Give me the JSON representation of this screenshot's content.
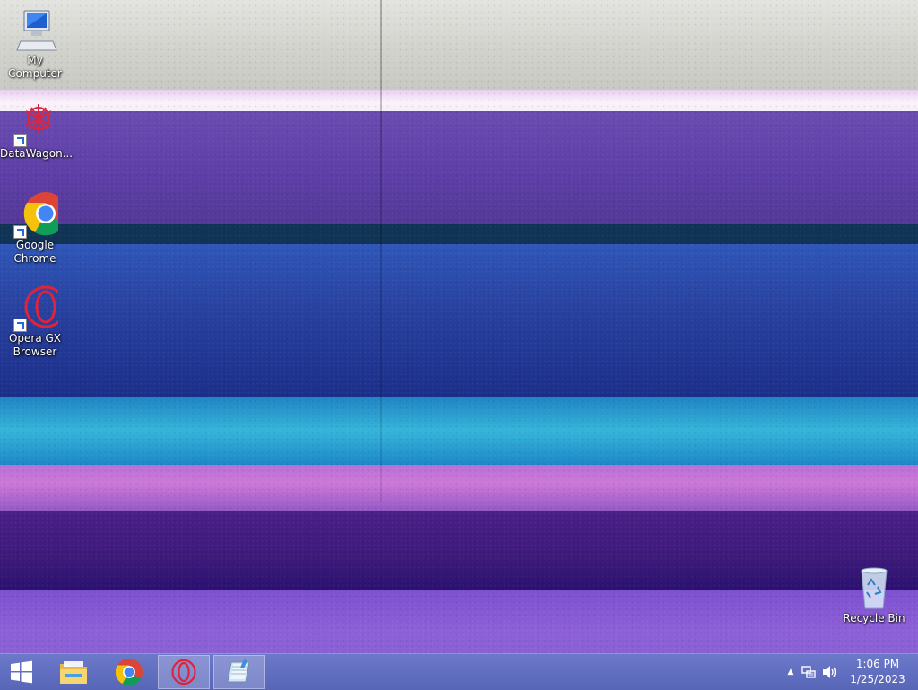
{
  "desktop": {
    "icons": [
      {
        "label": "My Computer",
        "icon": "computer-icon"
      },
      {
        "label": "DataWagon...",
        "icon": "datawagon-icon"
      },
      {
        "label": "Google Chrome",
        "icon": "chrome-icon"
      },
      {
        "label": "Opera GX Browser",
        "icon": "opera-gx-icon"
      },
      {
        "label": "Recycle Bin",
        "icon": "recycle-bin-icon"
      }
    ]
  },
  "taskbar": {
    "start": {
      "icon": "windows-start-icon"
    },
    "pinned": [
      {
        "name": "File Explorer",
        "icon": "file-explorer-icon"
      },
      {
        "name": "Google Chrome",
        "icon": "chrome-icon"
      },
      {
        "name": "Opera GX",
        "icon": "opera-gx-icon",
        "active": true
      },
      {
        "name": "Notepad",
        "icon": "notepad-icon",
        "active": true
      }
    ],
    "tray": {
      "icons": [
        "show-hidden-icons-chevron",
        "network-icon",
        "volume-icon"
      ],
      "time": "1:06 PM",
      "date": "1/25/2023"
    }
  },
  "colors": {
    "taskbar": "#5f6dbf",
    "opera_red": "#e0223a",
    "chrome_red": "#db4437",
    "chrome_yellow": "#f4c20d",
    "chrome_green": "#0f9d58",
    "chrome_blue": "#4285f4"
  }
}
